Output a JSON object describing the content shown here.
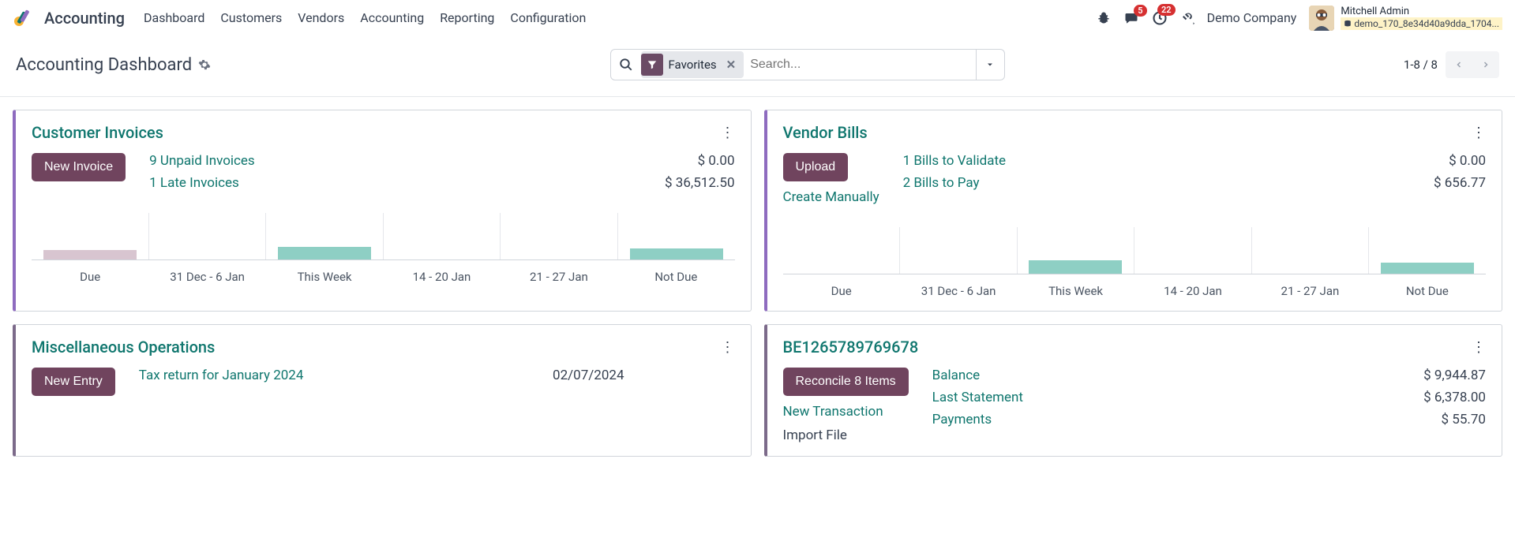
{
  "header": {
    "app_name": "Accounting",
    "menu": [
      "Dashboard",
      "Customers",
      "Vendors",
      "Accounting",
      "Reporting",
      "Configuration"
    ],
    "messages_badge": "5",
    "activities_badge": "22",
    "company": "Demo Company",
    "user_name": "Mitchell Admin",
    "db_name": "demo_170_8e34d40a9dda_1704..."
  },
  "control": {
    "title": "Accounting Dashboard",
    "filter_chip": "Favorites",
    "search_placeholder": "Search...",
    "pager": "1-8 / 8"
  },
  "chart_data": [
    {
      "type": "bar",
      "title": "Customer Invoices aging",
      "categories": [
        "Due",
        "31 Dec - 6 Jan",
        "This Week",
        "14 - 20 Jan",
        "21 - 27 Jan",
        "Not Due"
      ],
      "values": [
        12,
        0,
        16,
        0,
        0,
        14
      ],
      "colors": [
        "past",
        "none",
        "future",
        "none",
        "none",
        "future"
      ],
      "ylim": [
        0,
        60
      ]
    },
    {
      "type": "bar",
      "title": "Vendor Bills aging",
      "categories": [
        "Due",
        "31 Dec - 6 Jan",
        "This Week",
        "14 - 20 Jan",
        "21 - 27 Jan",
        "Not Due"
      ],
      "values": [
        0,
        0,
        17,
        0,
        0,
        14
      ],
      "colors": [
        "none",
        "none",
        "future",
        "none",
        "none",
        "future"
      ],
      "ylim": [
        0,
        60
      ]
    }
  ],
  "cards": {
    "customer_invoices": {
      "title": "Customer Invoices",
      "button": "New Invoice",
      "stats": [
        {
          "label": "9 Unpaid Invoices",
          "value": "$ 0.00"
        },
        {
          "label": "1 Late Invoices",
          "value": "$ 36,512.50"
        }
      ]
    },
    "vendor_bills": {
      "title": "Vendor Bills",
      "button": "Upload",
      "secondary": "Create Manually",
      "stats": [
        {
          "label": "1 Bills to Validate",
          "value": "$ 0.00"
        },
        {
          "label": "2 Bills to Pay",
          "value": "$ 656.77"
        }
      ]
    },
    "misc": {
      "title": "Miscellaneous Operations",
      "button": "New Entry",
      "tax_label": "Tax return for January 2024",
      "tax_date": "02/07/2024"
    },
    "bank": {
      "title": "BE1265789769678",
      "button": "Reconcile 8 Items",
      "secondary1": "New Transaction",
      "secondary2": "Import File",
      "stats": [
        {
          "label": "Balance",
          "value": "$ 9,944.87"
        },
        {
          "label": "Last Statement",
          "value": "$ 6,378.00"
        },
        {
          "label": "Payments",
          "value": "$ 55.70"
        }
      ]
    }
  }
}
